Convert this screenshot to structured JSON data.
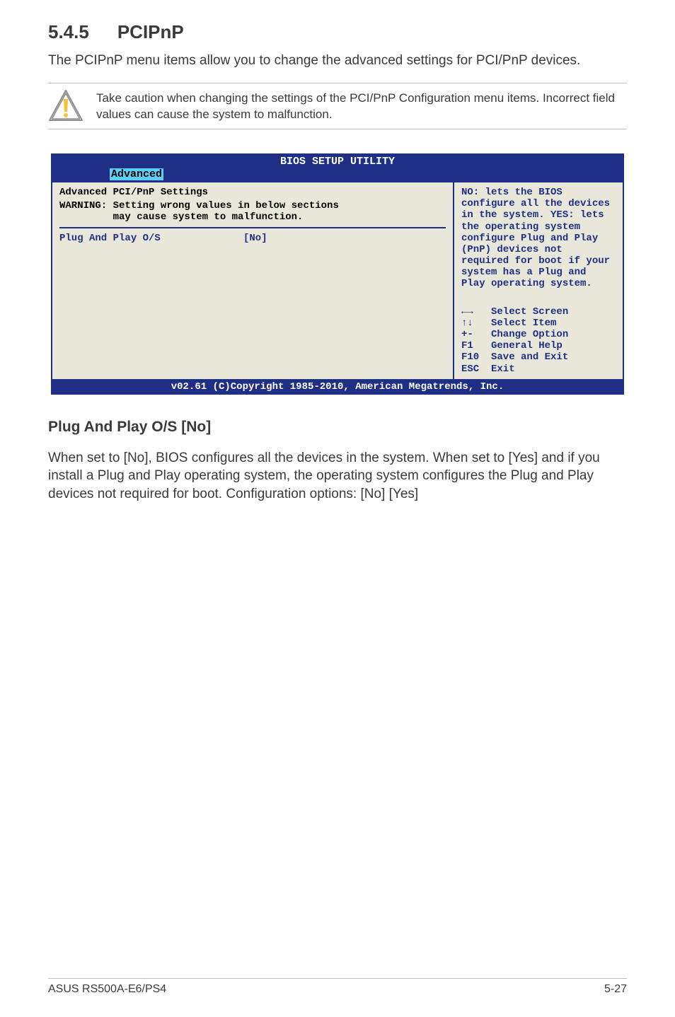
{
  "section": {
    "number": "5.4.5",
    "title": "PCIPnP"
  },
  "intro": "The PCIPnP menu items allow you to change the advanced settings for PCI/PnP devices.",
  "caution": "Take caution when changing the settings of the PCI/PnP Configuration menu items. Incorrect field values can cause the system to malfunction.",
  "bios": {
    "title": "BIOS SETUP UTILITY",
    "active_tab": "Advanced",
    "left": {
      "heading": "Advanced PCI/PnP Settings",
      "warning": "WARNING: Setting wrong values in below sections\n         may cause system to malfunction.",
      "row1_label": "Plug And Play O/S",
      "row1_value": "[No]"
    },
    "right": {
      "help": "NO: lets the BIOS configure all the devices in the system. YES: lets the operating system configure Plug and Play (PnP) devices not required for boot if your system has a Plug and Play operating system.",
      "keys": {
        "k1": "←→   Select Screen",
        "k2": "↑↓   Select Item",
        "k3": "+-   Change Option",
        "k4": "F1   General Help",
        "k5": "F10  Save and Exit",
        "k6": "ESC  Exit"
      }
    },
    "footer": "v02.61 (C)Copyright 1985-2010, American Megatrends, Inc."
  },
  "plug_section": {
    "heading": "Plug And Play O/S [No]",
    "body": "When set to [No], BIOS configures all the devices in the system. When set to [Yes] and if you install a Plug and Play operating system, the operating system configures the Plug and Play devices not required for boot. Configuration options: [No] [Yes]"
  },
  "footer": {
    "left": "ASUS RS500A-E6/PS4",
    "right": "5-27"
  }
}
